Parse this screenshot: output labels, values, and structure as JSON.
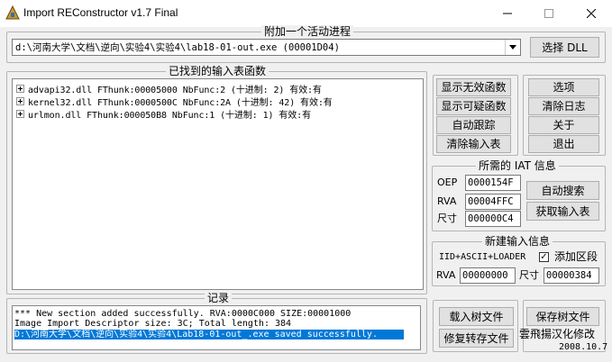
{
  "window": {
    "title": "Import REConstructor v1.7 Final"
  },
  "attach": {
    "group_title": "附加一个活动进程",
    "process": "d:\\河南大学\\文档\\逆向\\实验4\\实验4\\lab18-01-out.exe (00001D04)",
    "select_dll": "选择 DLL"
  },
  "imports": {
    "group_title": "已找到的输入表函数",
    "items": [
      {
        "label": "advapi32.dll FThunk:00005000 NbFunc:2 (十进制: 2) 有效:有"
      },
      {
        "label": "kernel32.dll FThunk:0000500C NbFunc:2A (十进制: 42) 有效:有"
      },
      {
        "label": "urlmon.dll FThunk:000050B8 NbFunc:1 (十进制: 1) 有效:有"
      }
    ]
  },
  "buttons": {
    "show_invalid": "显示无效函数",
    "show_suspect": "显示可疑函数",
    "auto_trace": "自动跟踪",
    "clear_imports": "清除输入表",
    "options": "选项",
    "clear_log": "清除日志",
    "about": "关于",
    "exit": "退出"
  },
  "iat": {
    "group_title": "所需的 IAT 信息",
    "oep_label": "OEP",
    "oep_value": "0000154F",
    "rva_label": "RVA",
    "rva_value": "00004FFC",
    "size_label": "尺寸",
    "size_value": "000000C4",
    "auto_search": "自动搜索",
    "get_imports": "获取输入表"
  },
  "new_import": {
    "group_title": "新建输入信息",
    "iid_label": "IID+ASCII+LOADER",
    "add_section_label": "添加区段",
    "add_section_checked": true,
    "rva_label": "RVA",
    "rva_value": "00000000",
    "size_label": "尺寸",
    "size_value": "00000384"
  },
  "log": {
    "group_title": "记录",
    "lines": [
      "*** New section added successfully. RVA:0000C000 SIZE:00001000",
      "Image Import Descriptor size: 3C; Total length: 384",
      "D:\\河南大学\\文档\\逆向\\实验4\\实验4\\Lab18-01-out_.exe saved successfully."
    ]
  },
  "bottom": {
    "load_tree": "载入树文件",
    "save_tree": "保存树文件",
    "fix_dump": "修复转存文件",
    "credit": "雲飛揚汉化修改",
    "date": "2008.10.7"
  }
}
